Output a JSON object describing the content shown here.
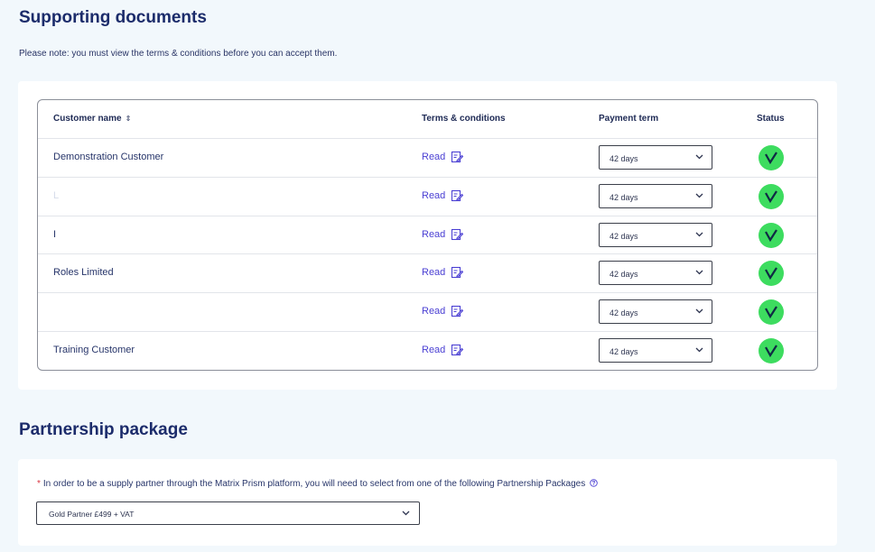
{
  "supporting_docs": {
    "title": "Supporting documents",
    "note": "Please note: you must view the terms & conditions before you can accept them.",
    "columns": {
      "customer_name": "Customer name",
      "sort_icon": "⇕",
      "terms": "Terms & conditions",
      "payment": "Payment term",
      "status": "Status"
    },
    "rows": [
      {
        "name": "Demonstration Customer",
        "read": "Read",
        "payment": "42 days",
        "status": "accepted"
      },
      {
        "name": "L",
        "read": "Read",
        "payment": "42 days",
        "status": "accepted"
      },
      {
        "name": "I",
        "read": "Read",
        "payment": "42 days",
        "status": "accepted"
      },
      {
        "name": "Roles Limited",
        "read": "Read",
        "payment": "42 days",
        "status": "accepted"
      },
      {
        "name": "",
        "read": "Read",
        "payment": "42 days",
        "status": "accepted"
      },
      {
        "name": "Training Customer",
        "read": "Read",
        "payment": "42 days",
        "status": "accepted"
      }
    ]
  },
  "partnership": {
    "title": "Partnership package",
    "required_mark": "*",
    "label": "In order to be a supply partner through the Matrix Prism platform, you will need to select from one of the following Partnership Packages",
    "selected": "Gold Partner £499 + VAT"
  },
  "colors": {
    "accent": "#4a3fd3",
    "status_ok": "#3ddc5f",
    "heading": "#1c2c6b",
    "background": "#f2f8fc"
  },
  "icons": {
    "read": "edit-document-icon",
    "status": "check-circle-icon",
    "dropdown": "chevron-down-icon",
    "help": "help-circle-icon"
  }
}
